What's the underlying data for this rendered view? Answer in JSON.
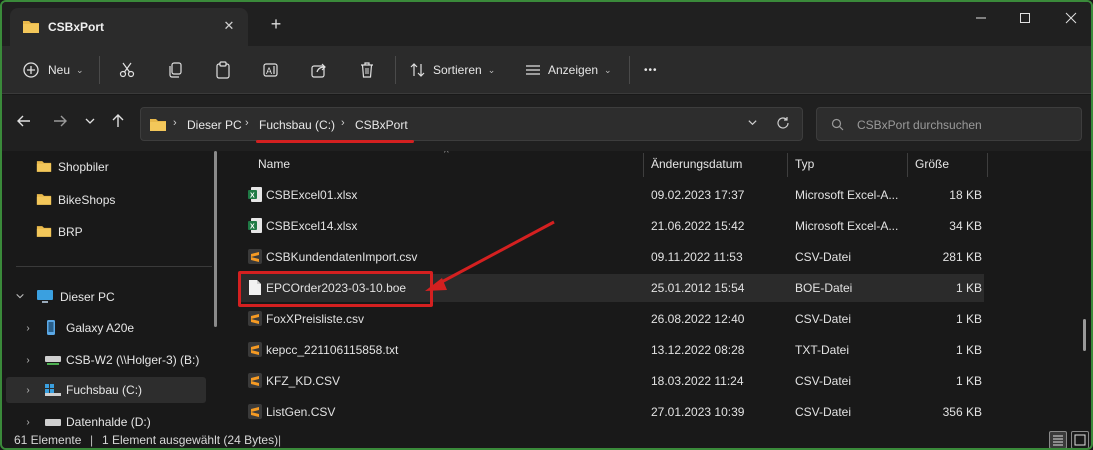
{
  "window": {
    "tab_title": "CSBxPort",
    "new_tab": "+",
    "close_tab": "✕"
  },
  "toolbar": {
    "new_label": "Neu",
    "sort_label": "Sortieren",
    "view_label": "Anzeigen",
    "more_label": "•••"
  },
  "address": {
    "crumbs": [
      "Dieser PC",
      "Fuchsbau (C:)",
      "CSBxPort"
    ],
    "search_placeholder": "CSBxPort durchsuchen"
  },
  "sidebar": {
    "quick_items": [
      {
        "label": "Shopbiler"
      },
      {
        "label": "BikeShops"
      },
      {
        "label": "BRP"
      }
    ],
    "pc_label": "Dieser PC",
    "drives": [
      {
        "label": "Galaxy A20e"
      },
      {
        "label": "CSB-W2 (\\\\Holger-3) (B:)"
      },
      {
        "label": "Fuchsbau (C:)"
      },
      {
        "label": "Datenhalde (D:)"
      }
    ]
  },
  "columns": {
    "name": "Name",
    "date": "Änderungsdatum",
    "type": "Typ",
    "size": "Größe"
  },
  "files": [
    {
      "name": "CSBExcel01.xlsx",
      "date": "09.02.2023 17:37",
      "type": "Microsoft Excel-A...",
      "size": "18 KB",
      "icon": "excel"
    },
    {
      "name": "CSBExcel14.xlsx",
      "date": "21.06.2022 15:42",
      "type": "Microsoft Excel-A...",
      "size": "34 KB",
      "icon": "excel"
    },
    {
      "name": "CSBKundendatenImport.csv",
      "date": "09.11.2022 11:53",
      "type": "CSV-Datei",
      "size": "281 KB",
      "icon": "sublime"
    },
    {
      "name": "EPCOrder2023-03-10.boe",
      "date": "25.01.2012 15:54",
      "type": "BOE-Datei",
      "size": "1 KB",
      "icon": "blank"
    },
    {
      "name": "FoxXPreisliste.csv",
      "date": "26.08.2022 12:40",
      "type": "CSV-Datei",
      "size": "1 KB",
      "icon": "sublime"
    },
    {
      "name": "kepcc_221106115858.txt",
      "date": "13.12.2022 08:28",
      "type": "TXT-Datei",
      "size": "1 KB",
      "icon": "sublime"
    },
    {
      "name": "KFZ_KD.CSV",
      "date": "18.03.2022 11:24",
      "type": "CSV-Datei",
      "size": "1 KB",
      "icon": "sublime"
    },
    {
      "name": "ListGen.CSV",
      "date": "27.01.2023 10:39",
      "type": "CSV-Datei",
      "size": "356 KB",
      "icon": "sublime"
    }
  ],
  "status": {
    "count": "61 Elemente",
    "selection": "1 Element ausgewählt (24 Bytes)"
  },
  "colors": {
    "accent_annotation": "#d42020",
    "folder": "#e8b84a",
    "excel": "#1f7a45",
    "sublime": "#f59a23"
  }
}
